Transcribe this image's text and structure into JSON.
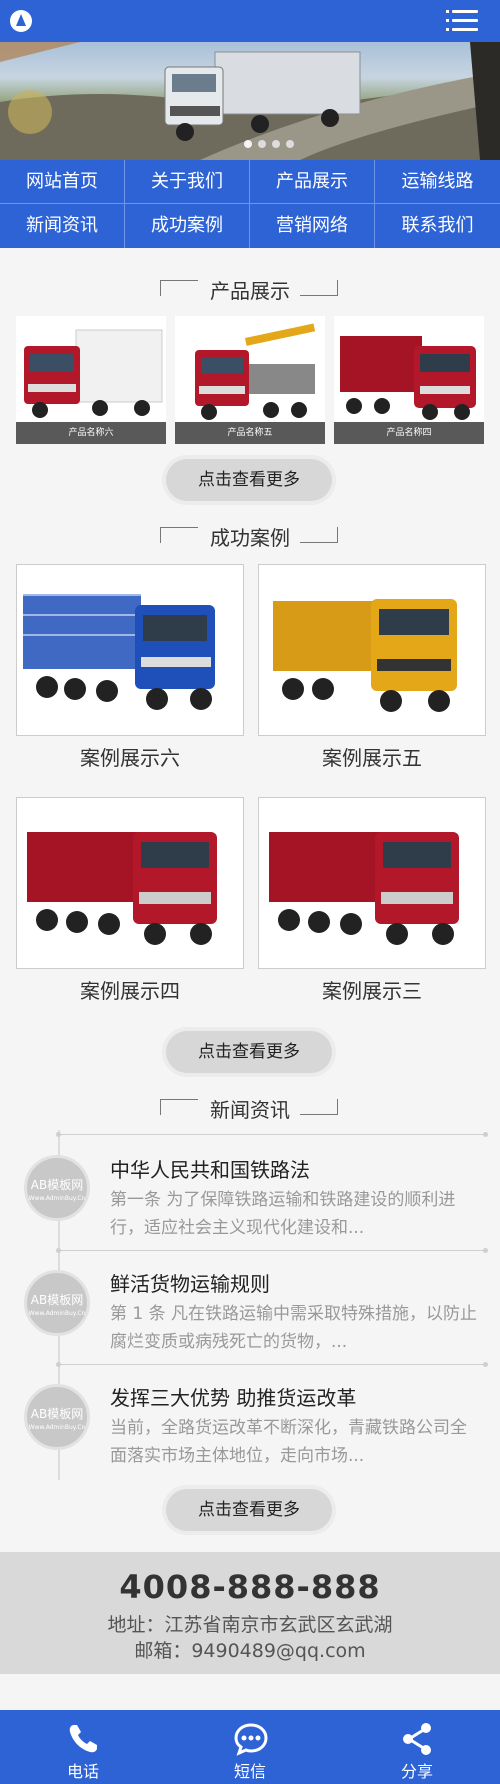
{
  "nav": {
    "items": [
      {
        "label": "网站首页"
      },
      {
        "label": "关于我们"
      },
      {
        "label": "产品展示"
      },
      {
        "label": "运输线路"
      },
      {
        "label": "新闻资讯"
      },
      {
        "label": "成功案例"
      },
      {
        "label": "营销网络"
      },
      {
        "label": "联系我们"
      }
    ]
  },
  "products": {
    "title": "产品展示",
    "items": [
      {
        "name": "产品名称六"
      },
      {
        "name": "产品名称五"
      },
      {
        "name": "产品名称四"
      }
    ],
    "more": "点击查看更多"
  },
  "cases": {
    "title": "成功案例",
    "items": [
      {
        "name": "案例展示六"
      },
      {
        "name": "案例展示五"
      },
      {
        "name": "案例展示四"
      },
      {
        "name": "案例展示三"
      }
    ],
    "more": "点击查看更多"
  },
  "news": {
    "title": "新闻资讯",
    "thumb_text": "AB模板网",
    "thumb_sub": "Www.AdminBuy.Cn",
    "items": [
      {
        "title": "中华人民共和国铁路法",
        "desc": "第一条 为了保障铁路运输和铁路建设的顺利进行，适应社会主义现代化建设和..."
      },
      {
        "title": "鲜活货物运输规则",
        "desc": "第 1 条 凡在铁路运输中需采取特殊措施，以防止腐烂变质或病残死亡的货物，..."
      },
      {
        "title": "发挥三大优势 助推货运改革",
        "desc": "当前，全路货运改革不断深化，青藏铁路公司全面落实市场主体地位，走向市场..."
      }
    ],
    "more": "点击查看更多"
  },
  "contact": {
    "phone": "4008-888-888",
    "address": "地址：江苏省南京市玄武区玄武湖",
    "email": "邮箱：9490489@qq.com"
  },
  "bottom_bar": {
    "items": [
      {
        "label": "电话",
        "icon": "phone-icon"
      },
      {
        "label": "短信",
        "icon": "sms-icon"
      },
      {
        "label": "分享",
        "icon": "share-icon"
      }
    ]
  },
  "colors": {
    "brand": "#2e63d6",
    "truck_red": "#b3172a",
    "truck_blue": "#1f4fb8",
    "truck_yellow": "#e3a718"
  }
}
